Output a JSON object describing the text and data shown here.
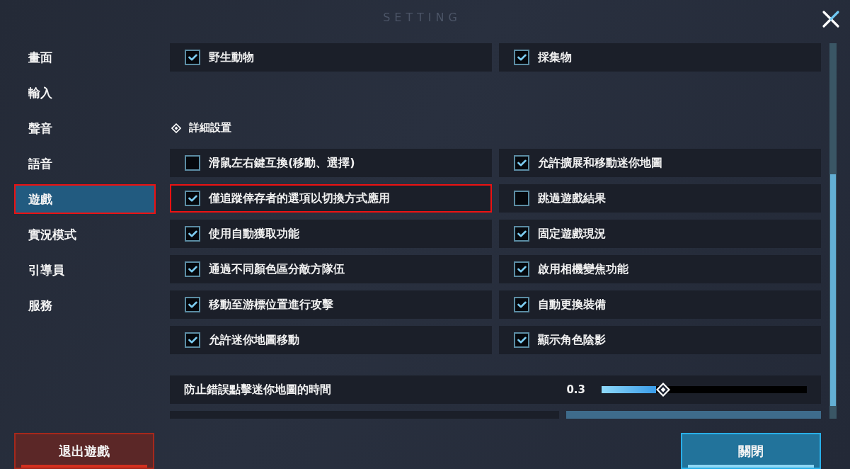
{
  "window": {
    "title": "SETTING"
  },
  "sidebar": {
    "items": [
      {
        "label": "畫面",
        "selected": false,
        "annotated": false
      },
      {
        "label": "輸入",
        "selected": false,
        "annotated": false
      },
      {
        "label": "聲音",
        "selected": false,
        "annotated": false
      },
      {
        "label": "語音",
        "selected": false,
        "annotated": false
      },
      {
        "label": "遊戲",
        "selected": true,
        "annotated": true
      },
      {
        "label": "實況模式",
        "selected": false,
        "annotated": false
      },
      {
        "label": "引導員",
        "selected": false,
        "annotated": false
      },
      {
        "label": "服務",
        "selected": false,
        "annotated": false
      }
    ]
  },
  "top_options": [
    {
      "label": "野生動物",
      "checked": true,
      "annotated": false
    },
    {
      "label": "採集物",
      "checked": true,
      "annotated": false
    }
  ],
  "section": {
    "title": "詳細設置"
  },
  "options": [
    {
      "label": "滑鼠左右鍵互換(移動、選擇)",
      "checked": false,
      "annotated": false
    },
    {
      "label": "允許擴展和移動迷你地圖",
      "checked": true,
      "annotated": false
    },
    {
      "label": "僅追蹤倖存者的選項以切換方式應用",
      "checked": true,
      "annotated": true
    },
    {
      "label": "跳過遊戲結果",
      "checked": false,
      "annotated": false
    },
    {
      "label": "使用自動獲取功能",
      "checked": true,
      "annotated": false
    },
    {
      "label": "固定遊戲現況",
      "checked": true,
      "annotated": false
    },
    {
      "label": "通過不同顏色區分敵方隊伍",
      "checked": true,
      "annotated": false
    },
    {
      "label": "啟用相機變焦功能",
      "checked": true,
      "annotated": false
    },
    {
      "label": "移動至游標位置進行攻擊",
      "checked": true,
      "annotated": false
    },
    {
      "label": "自動更換裝備",
      "checked": true,
      "annotated": false
    },
    {
      "label": "允許迷你地圖移動",
      "checked": true,
      "annotated": false
    },
    {
      "label": "顯示角色陰影",
      "checked": true,
      "annotated": false
    }
  ],
  "slider": {
    "label": "防止錯誤點擊迷你地圖的時間",
    "reading": "0.3",
    "level": 0.3
  },
  "buttons": [
    {
      "kind": "exit",
      "label": "退出遊戲"
    },
    {
      "kind": "close",
      "label": "關閉"
    }
  ]
}
